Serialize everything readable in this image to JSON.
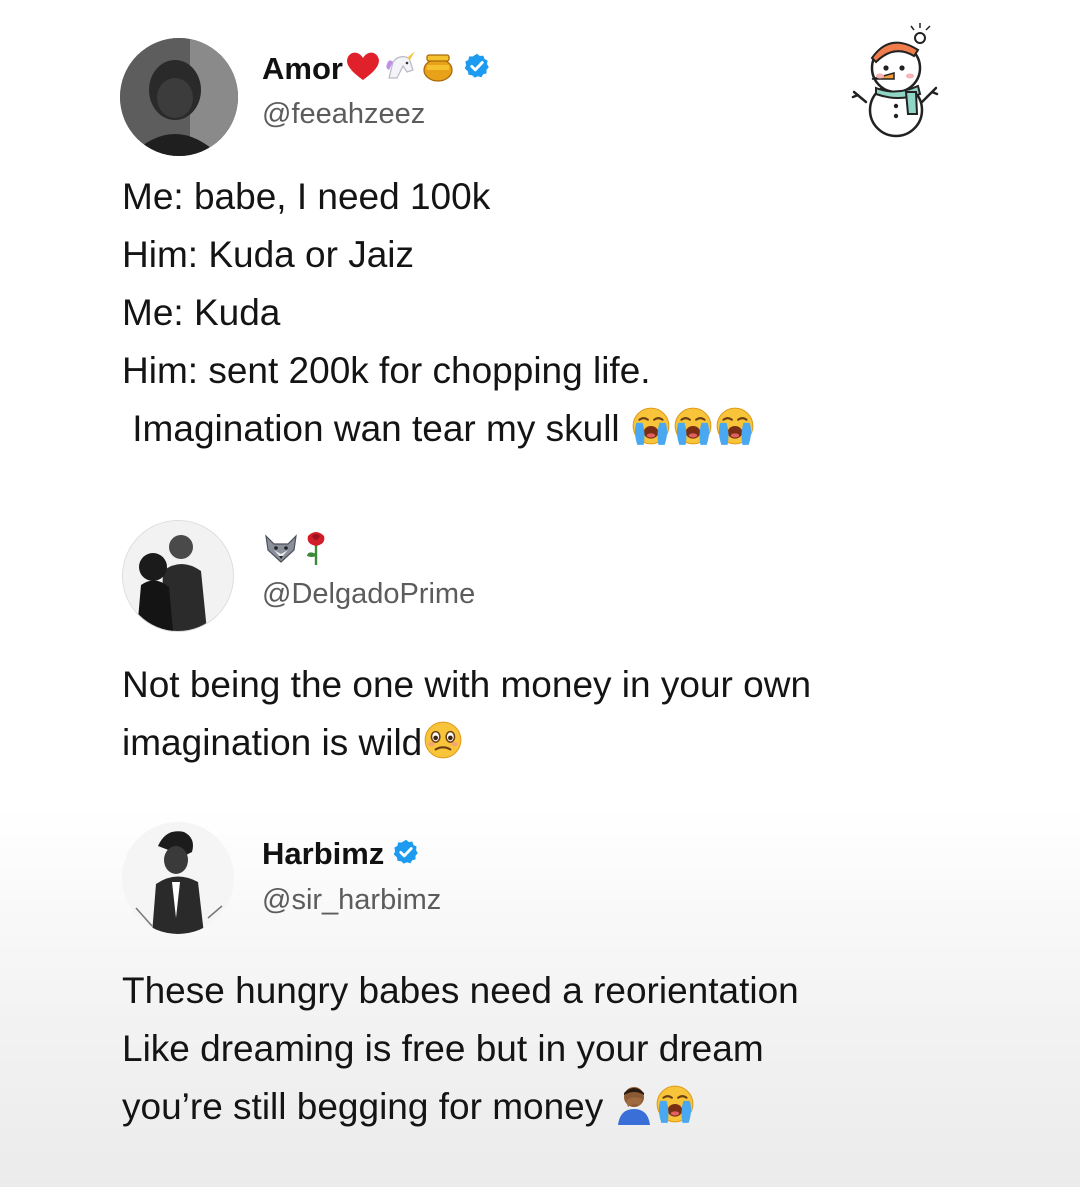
{
  "tweets": [
    {
      "name": "Amor",
      "handle": "@feeahzeez",
      "verified": true,
      "lines": [
        "Me: babe, I need 100k",
        "Him: Kuda or Jaiz",
        "Me: Kuda",
        "Him: sent 200k for chopping life.",
        " Imagination wan tear my skull"
      ],
      "name_emoji_icons": [
        "red-heart-icon",
        "unicorn-icon",
        "honey-pot-icon"
      ],
      "trailing_emoji_icons": [
        "loudly-crying-face-icon",
        "loudly-crying-face-icon",
        "loudly-crying-face-icon"
      ]
    },
    {
      "name": "",
      "handle": "@DelgadoPrime",
      "verified": false,
      "name_emoji_icons": [
        "wolf-icon",
        "rose-icon"
      ],
      "lines": [
        "Not being the one with money in your own",
        "imagination is wild"
      ],
      "trailing_emoji_icons": [
        "face-holding-back-tears-icon"
      ]
    },
    {
      "name": "Harbimz",
      "handle": "@sir_harbimz",
      "verified": true,
      "lines": [
        "These hungry babes need a reorientation",
        "Like dreaming is free but in your dream",
        "you’re still begging for money"
      ],
      "trailing_emoji_icons": [
        "person-facepalming-icon",
        "loudly-crying-face-icon"
      ]
    }
  ],
  "decoration": {
    "sticker_icon": "snowman-icon"
  },
  "colors": {
    "verified_blue": "#1d9bf0",
    "handle_gray": "#5c5c5c",
    "text": "#141414"
  }
}
